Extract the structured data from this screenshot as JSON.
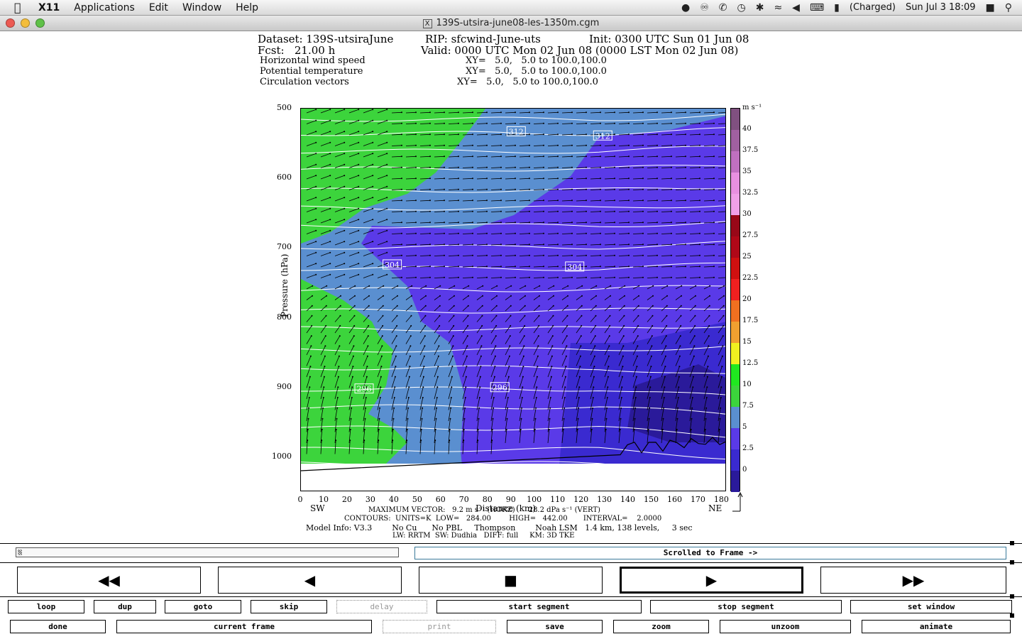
{
  "menubar": {
    "app": "X11",
    "items": [
      "Applications",
      "Edit",
      "Window",
      "Help"
    ],
    "battery": "(Charged)",
    "clock": "Sun Jul 3  18:09"
  },
  "window": {
    "title": "139S-utsira-june08-les-1350m.cgm"
  },
  "header": {
    "dataset": "Dataset: 139S-utsiraJune",
    "rip": "RIP: sfcwind-June-uts",
    "init": "Init: 0300 UTC Sun 01 Jun 08",
    "fcst": "Fcst:   21.00 h",
    "valid": "Valid: 0000 UTC Mon 02 Jun 08 (0000 LST Mon 02 Jun 08)",
    "fields": [
      {
        "name": "Horizontal wind speed",
        "xy": "XY=   5.0,   5.0 to 100.0,100.0"
      },
      {
        "name": "Potential temperature",
        "xy": "XY=   5.0,   5.0 to 100.0,100.0"
      },
      {
        "name": "Circulation vectors",
        "xy": "XY=   5.0,   5.0 to 100.0,100.0"
      }
    ]
  },
  "chart_data": {
    "type": "heatmap",
    "ylabel": "Pressure (hPa)",
    "xlabel": "Distance (km)",
    "y_ticks": [
      500,
      600,
      700,
      800,
      900,
      1000
    ],
    "x_ticks": [
      0,
      10,
      20,
      30,
      40,
      50,
      60,
      70,
      80,
      90,
      100,
      110,
      120,
      130,
      140,
      150,
      160,
      170,
      180
    ],
    "xlim": [
      0,
      182
    ],
    "ylim": [
      500,
      1050
    ],
    "left_label": "SW",
    "right_label": "NE",
    "contour_labels": [
      {
        "text": "312",
        "x": 92,
        "p": 533
      },
      {
        "text": "312",
        "x": 129,
        "p": 539
      },
      {
        "text": "304",
        "x": 39,
        "p": 724
      },
      {
        "text": "304",
        "x": 117,
        "p": 727
      },
      {
        "text": "296",
        "x": 27,
        "p": 902
      },
      {
        "text": "296",
        "x": 85,
        "p": 900
      }
    ],
    "colorbar": {
      "unit": "m s⁻¹",
      "levels": [
        "0",
        "2.5",
        "5",
        "7.5",
        "10",
        "12.5",
        "15",
        "17.5",
        "20",
        "22.5",
        "25",
        "27.5",
        "30",
        "32.5",
        "35",
        "37.5",
        "40"
      ],
      "colors": [
        "#2a1a9a",
        "#3a2ad0",
        "#5a3ae8",
        "#5a8fd0",
        "#3cd43c",
        "#20e820",
        "#f0f020",
        "#f0a030",
        "#f07020",
        "#f02020",
        "#d01010",
        "#b00818",
        "#980818",
        "#f0a0e8",
        "#e890e0",
        "#c070c0",
        "#a060a0",
        "#805080"
      ]
    }
  },
  "footer": {
    "maxvec": "MAXIMUM VECTOR:   9.2 m s⁻¹ (HORZ)      28.2 dPa s⁻¹ (VERT)",
    "contours": "CONTOURS:  UNITS=K  LOW=   284.00        HIGH=   442.00       INTERVAL=    2.0000",
    "model": "Model Info: V3.3        No Cu      No PBL     Thompson        Noah LSM   1.4 km, 138 levels,     3 sec",
    "physics": "LW: RRTM  SW: Dudhia   DIFF: full     KM: 3D TKE"
  },
  "controls": {
    "status": "Scrolled to Frame ->",
    "row1": [
      "loop",
      "dup",
      "goto",
      "skip",
      "delay",
      "start segment",
      "stop segment",
      "set window"
    ],
    "row2": [
      "done",
      "current frame",
      "print",
      "save",
      "zoom",
      "unzoom",
      "animate"
    ]
  }
}
